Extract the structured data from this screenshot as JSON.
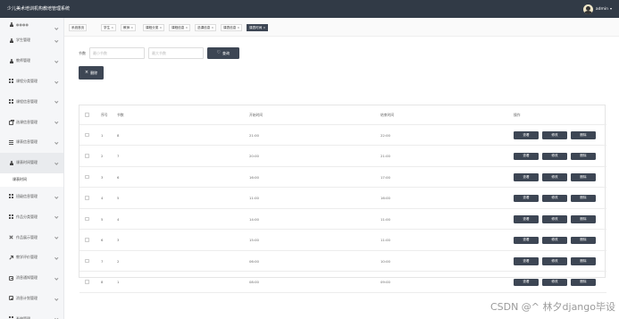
{
  "header": {
    "app_title": "少儿美术培训机构教培管理系统",
    "username": "admin"
  },
  "sidebar": {
    "partial_top": "●●●●",
    "items": [
      {
        "label": "学生管理",
        "icon": "person-icon"
      },
      {
        "label": "教师管理",
        "icon": "person-icon"
      },
      {
        "label": "课程分类管理",
        "icon": "grid-icon"
      },
      {
        "label": "课程信息管理",
        "icon": "grid-icon"
      },
      {
        "label": "选课信息管理",
        "icon": "briefcase-icon"
      },
      {
        "label": "课表信息管理",
        "icon": "bars-icon"
      },
      {
        "label": "课表时间管理",
        "icon": "person-icon"
      }
    ],
    "active_sub": "课表时间",
    "items_after": [
      {
        "label": "班级信息管理",
        "icon": "grid-icon"
      },
      {
        "label": "作品分类管理",
        "icon": "grid-icon"
      },
      {
        "label": "作品展示管理",
        "icon": "cross-icon"
      },
      {
        "label": "教学评价管理",
        "icon": "arrow-icon"
      },
      {
        "label": "消息通知管理",
        "icon": "box-icon"
      },
      {
        "label": "消息计划管理",
        "icon": "box-icon"
      },
      {
        "label": "系统管理",
        "icon": "grid-icon"
      }
    ]
  },
  "tabs": [
    {
      "label": "系统首页",
      "closable": false
    },
    {
      "label": "学生",
      "closable": true
    },
    {
      "label": "教师",
      "closable": true
    },
    {
      "label": "课程分类",
      "closable": true
    },
    {
      "label": "课程信息",
      "closable": true
    },
    {
      "label": "选课信息",
      "closable": true
    },
    {
      "label": "课表信息",
      "closable": true
    },
    {
      "label": "课表时间",
      "closable": true,
      "active": true
    }
  ],
  "search": {
    "label": "节数",
    "min_placeholder": "最小节数",
    "max_placeholder": "最大节数",
    "button_label": "查询"
  },
  "toolbar": {
    "delete_label": "删除"
  },
  "table": {
    "headers": {
      "index": "序号",
      "section": "节数",
      "start": "开始时间",
      "end": "结束时间",
      "actions": "操作"
    },
    "rows": [
      {
        "index": "1",
        "section": "8",
        "start": "21:00",
        "end": "22:00"
      },
      {
        "index": "2",
        "section": "7",
        "start": "20:00",
        "end": "21:00"
      },
      {
        "index": "3",
        "section": "6",
        "start": "16:00",
        "end": "17:00"
      },
      {
        "index": "4",
        "section": "5",
        "start": "11:00",
        "end": "16:00"
      },
      {
        "index": "5",
        "section": "4",
        "start": "14:00",
        "end": "11:00"
      },
      {
        "index": "6",
        "section": "3",
        "start": "15:00",
        "end": "11:00"
      },
      {
        "index": "7",
        "section": "2",
        "start": "06:00",
        "end": "10:00"
      },
      {
        "index": "8",
        "section": "1",
        "start": "08:00",
        "end": "09:00"
      }
    ],
    "action_labels": {
      "view": "查看",
      "edit": "修改",
      "delete": "删除"
    }
  },
  "watermark": "CSDN @^ 林夕django毕设"
}
